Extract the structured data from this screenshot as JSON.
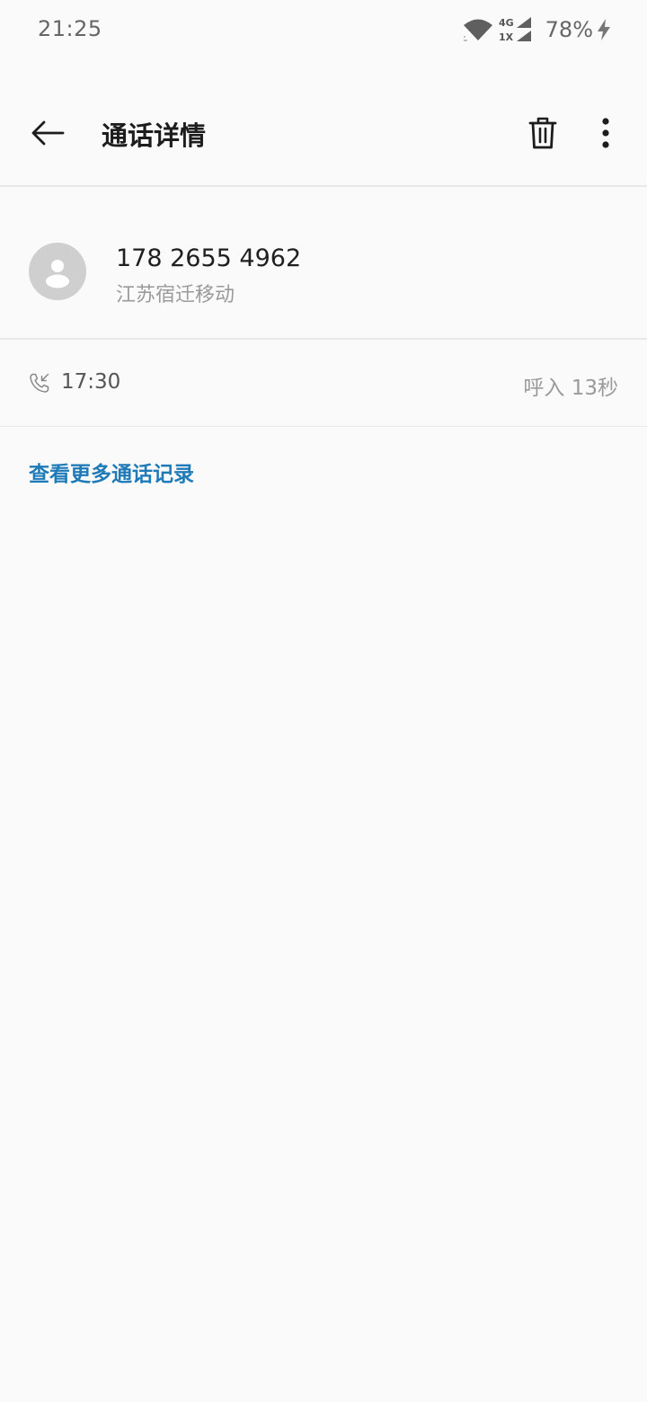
{
  "status_bar": {
    "time": "21:25",
    "network_top": "4G",
    "network_bottom": "1X",
    "battery": "78%",
    "icons": [
      "wifi-icon",
      "signal-icon",
      "charging-icon"
    ]
  },
  "app_bar": {
    "title": "通话详情",
    "icons": [
      "back-arrow-icon",
      "trash-icon",
      "more-vertical-icon"
    ]
  },
  "contact": {
    "phone_number": "178 2655 4962",
    "location": "江苏宿迁移动",
    "avatar_icon": "person-icon"
  },
  "call_record": {
    "time": "17:30",
    "info": "呼入 13秒",
    "icon": "incoming-call-icon"
  },
  "more_records_link": "查看更多通话记录",
  "colors": {
    "background": "#fafafa",
    "link": "#1f7ab8",
    "avatar": "#cfcfcf",
    "divider": "#e8e8e8"
  }
}
